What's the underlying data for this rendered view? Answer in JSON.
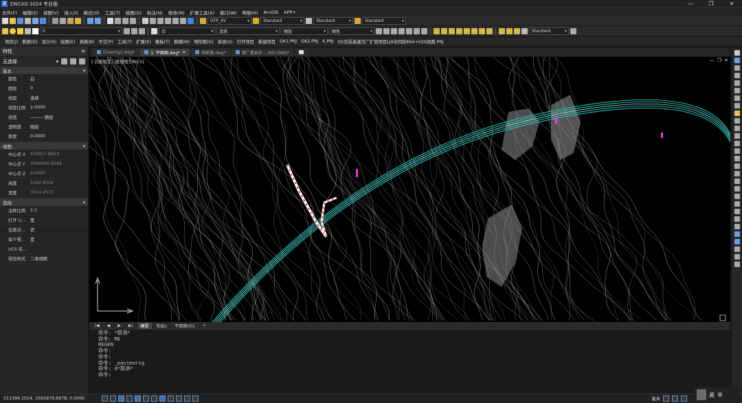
{
  "app": {
    "title": "ZWCAD 2024 专业版",
    "logo_letter": "Z"
  },
  "window_controls": [
    "—",
    "❐",
    "✕"
  ],
  "menu": [
    "文件(F)",
    "编辑(E)",
    "视图(V)",
    "插入(I)",
    "格式(O)",
    "工具(T)",
    "绘图(D)",
    "标注(N)",
    "修改(M)",
    "扩展工具(X)",
    "窗口(W)",
    "帮助(H)",
    "ArcGIS",
    "APP+"
  ],
  "toolbar1": {
    "text_style": "GTP_XV",
    "dim_style": "Standard",
    "table_style": "Standard",
    "multileader_style": "Standard"
  },
  "toolbar2": {
    "layer": "0",
    "color": "白",
    "linetype": "连续",
    "lineweight": "随层",
    "plotstyle": "随色",
    "visual_style": "Standard"
  },
  "plugins": [
    "项目(J)",
    "数据(D)",
    "设计(S)",
    "绘图(E)",
    "表格(B)",
    "平交(P)",
    "工具(T)",
    "扩展(K)",
    "模板(T)",
    "数模(M)",
    "地形图(G)",
    "系统(X)",
    "打开项目",
    "新建项目",
    "GK1.PRJ",
    "GK2.PRJ",
    "K.PRJ",
    "G5京昆高速汉广扩容项目LJ9合同段K64+020改路.PRJ"
  ],
  "properties": {
    "title": "特性",
    "selection": "无选择",
    "sections": {
      "basic": "基本",
      "view": "视图",
      "misc": "其他"
    },
    "basic_rows": [
      {
        "k": "颜色",
        "v": "白"
      },
      {
        "k": "图层",
        "v": "0"
      },
      {
        "k": "线型",
        "v": "连续"
      },
      {
        "k": "线型比例",
        "v": "2.0000"
      },
      {
        "k": "线宽",
        "v": "——— 随层"
      },
      {
        "k": "透明度",
        "v": "随层"
      },
      {
        "k": "厚度",
        "v": "0.0000"
      }
    ],
    "view_rows": [
      {
        "k": "中心点 X",
        "v": "509917.8423"
      },
      {
        "k": "中心点 Y",
        "v": "3566490.8549"
      },
      {
        "k": "中心点 Z",
        "v": "0.0000"
      },
      {
        "k": "高度",
        "v": "1242.8504"
      },
      {
        "k": "宽度",
        "v": "3014.4573"
      }
    ],
    "misc_rows": [
      {
        "k": "注释比例",
        "v": "1:1"
      },
      {
        "k": "打开 U...",
        "v": "是"
      },
      {
        "k": "在原点...",
        "v": "否"
      },
      {
        "k": "每个视...",
        "v": "是"
      },
      {
        "k": "UCS 名...",
        "v": ""
      },
      {
        "k": "视觉样式",
        "v": "二维线框"
      }
    ]
  },
  "doc_tabs": [
    {
      "label": "Drawing1.dwg*",
      "active": false
    },
    {
      "label": "1. 平面图.dwg*",
      "active": true
    },
    {
      "label": "纵断面.dwg*",
      "active": false
    },
    {
      "label": "镇广基本农...-400.DWG*",
      "active": false
    }
  ],
  "viewport_label": "[-][俯视][二维线框][WCS]",
  "layout_tabs": [
    {
      "label": "模型",
      "active": true
    },
    {
      "label": "布局1",
      "active": false
    },
    {
      "label": "平面图001",
      "active": false
    },
    {
      "label": "+",
      "active": false
    }
  ],
  "command_history": [
    "命令: *取消*",
    "命令: RE",
    "REGEN",
    "命令:",
    "命令:",
    "命令: _pasteorig",
    "命令: d*取消*",
    "",
    "",
    "命令:"
  ],
  "status": {
    "coords": "511394.1014, 3565876.6978, 0.0000",
    "scale": "毫米"
  },
  "ime": {
    "lang": "英",
    "mode": "半"
  },
  "colors": {
    "contour": "#c9c9c9",
    "road": "#22d3c8",
    "red_route": "#e01b1b",
    "hatch": "#8a8a8a",
    "magenta": "#e03ee0"
  }
}
